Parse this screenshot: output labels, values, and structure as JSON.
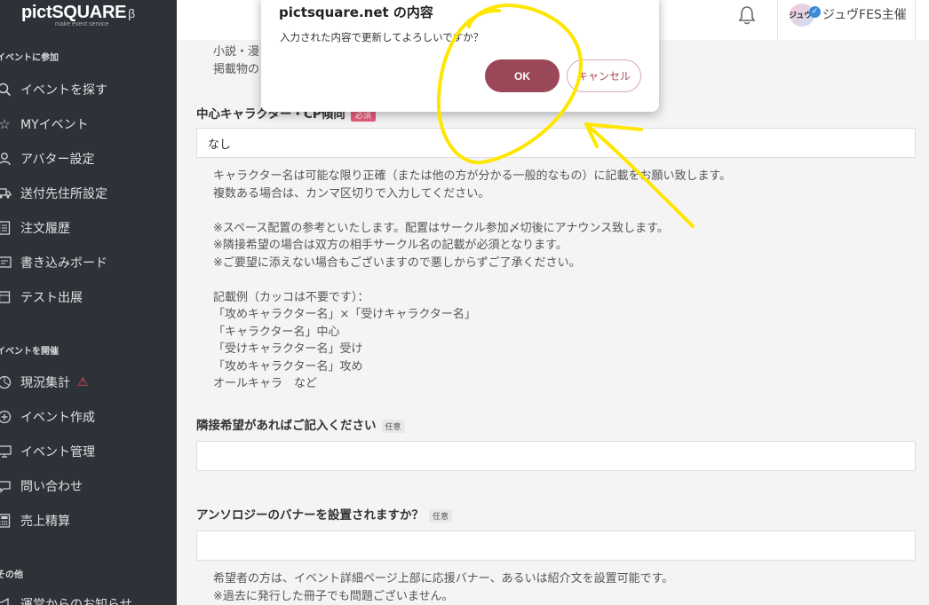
{
  "sidebar": {
    "logo": "pictSQUARE",
    "logo_beta": "β",
    "logo_sub": "make event service",
    "sections": [
      {
        "label": "イベントに参加"
      },
      {
        "label": "イベントを開催"
      },
      {
        "label": "その他"
      }
    ],
    "items": [
      {
        "label": "イベントを探す",
        "icon": "search-icon"
      },
      {
        "label": "MYイベント",
        "icon": "star-icon"
      },
      {
        "label": "アバター設定",
        "icon": "person-icon"
      },
      {
        "label": "送付先住所設定",
        "icon": "truck-icon"
      },
      {
        "label": "注文履歴",
        "icon": "document-icon"
      },
      {
        "label": "書き込みボード",
        "icon": "board-icon"
      },
      {
        "label": "テスト出展",
        "icon": "flask-icon"
      },
      {
        "label": "現況集計",
        "icon": "chart-icon",
        "warning": "⚠"
      },
      {
        "label": "イベント作成",
        "icon": "plus-circle-icon"
      },
      {
        "label": "イベント管理",
        "icon": "monitor-icon"
      },
      {
        "label": "問い合わせ",
        "icon": "chat-icon"
      },
      {
        "label": "売上精算",
        "icon": "calculator-icon"
      },
      {
        "label": "運営からのお知らせ",
        "icon": "megaphone-icon"
      }
    ]
  },
  "topbar": {
    "host_badge": "ジュヴFES",
    "host_name": "ジュヴFES主催"
  },
  "main": {
    "top_note_line1": "小説・漫",
    "top_note_line2": "掲載物の",
    "field1": {
      "label": "中心キャラクター・CP傾向",
      "tag": "必須",
      "value": "なし"
    },
    "note1": "キャラクター名は可能な限り正確（または他の方が分かる一般的なもの）に記載をお願い致します。\n複数ある場合は、カンマ区切りで入力してください。\n\n※スペース配置の参考といたします。配置はサークル参加〆切後にアナウンス致します。\n※隣接希望の場合は双方の相手サークル名の記載が必須となります。\n※ご要望に添えない場合もございますので悪しからずご了承ください。\n\n記載例（カッコは不要です）：\n「攻めキャラクター名」×「受けキャラクター名」\n「キャラクター名」中心\n「受けキャラクター名」受け\n「攻めキャラクター名」攻め\nオールキャラ　など",
    "field2": {
      "label": "隣接希望があればご記入ください",
      "tag": "任意",
      "value": ""
    },
    "field3": {
      "label": "アンソロジーのバナーを設置されますか？",
      "tag": "任意",
      "value": ""
    },
    "note3": "希望者の方は、イベント詳細ページ上部に応援バナー、あるいは紹介文を設置可能です。\n※過去に発行した冊子でも問題ございません。"
  },
  "dialog": {
    "title": "pictsquare.net の内容",
    "message": "入力された内容で更新してよろしいですか？",
    "ok_label": "OK",
    "cancel_label": "キャンセル"
  },
  "colors": {
    "sidebar_bg": "#2d3239",
    "ok_button": "#9a4858",
    "required_tag": "#e85a7a",
    "annotation": "#ffe600"
  }
}
